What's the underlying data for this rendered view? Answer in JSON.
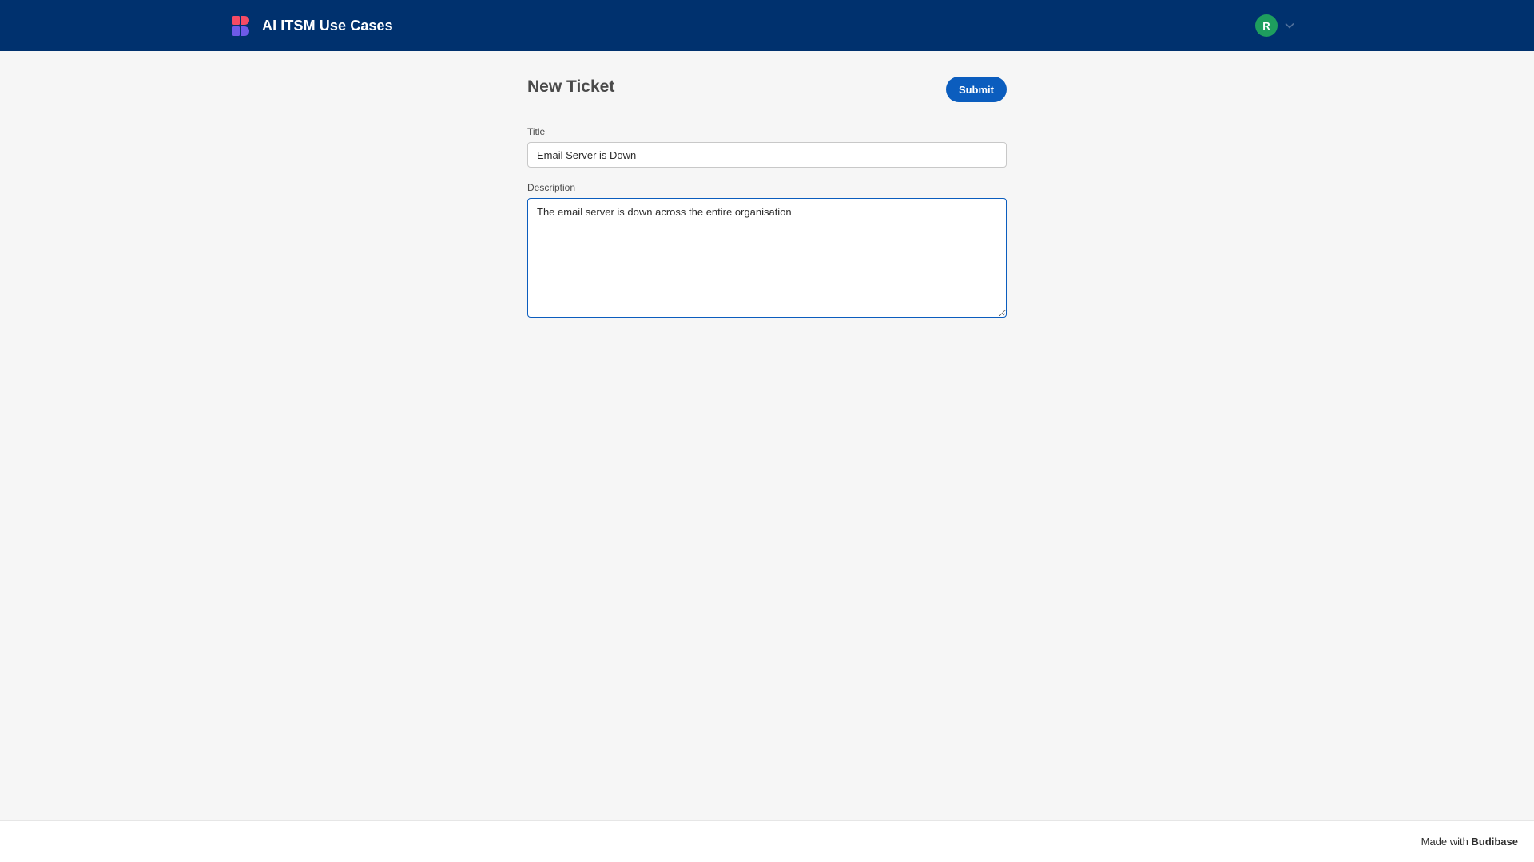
{
  "header": {
    "app_title": "AI ITSM Use Cases",
    "logo_icon": "budibase-logo-icon",
    "user_initial": "R",
    "avatar_color": "#1e9e5e",
    "bar_color": "#00316e"
  },
  "form": {
    "page_title": "New Ticket",
    "submit_label": "Submit",
    "title_label": "Title",
    "title_value": "Email Server is Down",
    "description_label": "Description",
    "description_value": "The email server is down across the entire organisation"
  },
  "footer": {
    "made_with": "Made with",
    "brand": "Budibase"
  }
}
